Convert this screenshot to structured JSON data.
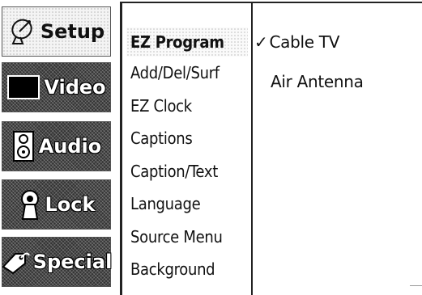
{
  "tabs": [
    {
      "label": "Setup",
      "icon": "satellite-dish-icon",
      "active": true
    },
    {
      "label": "Video",
      "icon": "tv-screen-icon",
      "active": false
    },
    {
      "label": "Audio",
      "icon": "speaker-icon",
      "active": false
    },
    {
      "label": "Lock",
      "icon": "keyhole-icon",
      "active": false
    },
    {
      "label": "Special",
      "icon": "tag-icon",
      "active": false
    }
  ],
  "menu": {
    "items": [
      {
        "label": "EZ Program",
        "selected": true
      },
      {
        "label": "Add/Del/Surf"
      },
      {
        "label": "EZ Clock"
      },
      {
        "label": "Captions"
      },
      {
        "label": "Caption/Text"
      },
      {
        "label": "Language"
      },
      {
        "label": "Source Menu"
      },
      {
        "label": "Background"
      }
    ]
  },
  "options": {
    "check_mark": "✓",
    "items": [
      {
        "label": "Cable TV",
        "checked": true
      },
      {
        "label": "Air Antenna",
        "checked": false
      }
    ]
  }
}
